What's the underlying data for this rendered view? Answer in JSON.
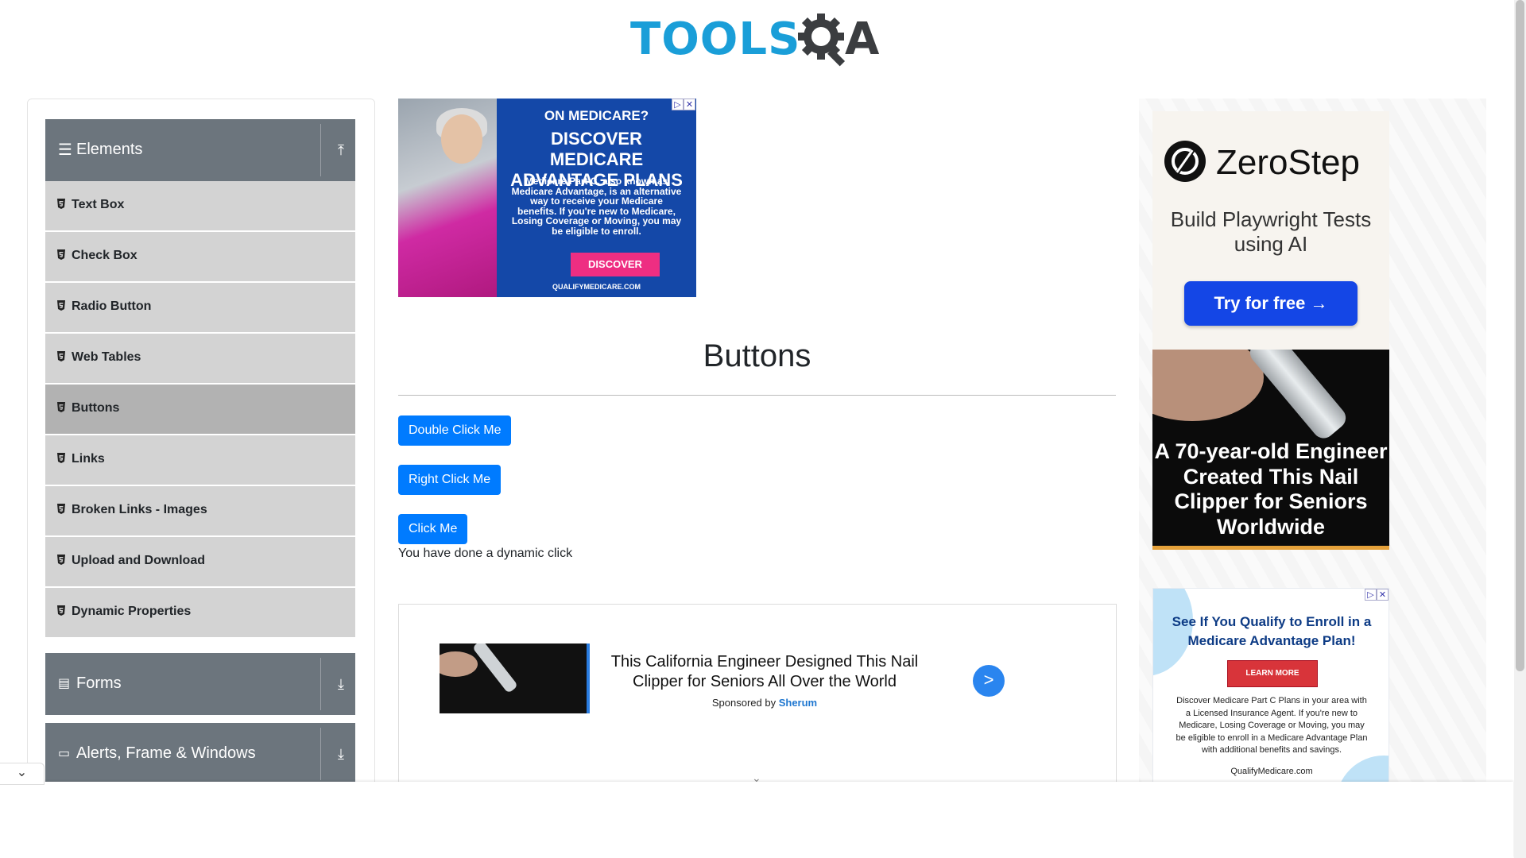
{
  "header": {
    "logo_text_left": "TOOLS",
    "logo_text_right": "A"
  },
  "sidebar": {
    "groups": [
      {
        "label": "Elements",
        "icon": "hamburger-icon",
        "arrow": "collapse-up-icon"
      },
      {
        "label": "Forms",
        "icon": "document-icon",
        "arrow": "expand-down-icon"
      },
      {
        "label": "Alerts, Frame & Windows",
        "icon": "window-icon",
        "arrow": "expand-down-icon"
      }
    ],
    "items": [
      {
        "label": "Text Box"
      },
      {
        "label": "Check Box"
      },
      {
        "label": "Radio Button"
      },
      {
        "label": "Web Tables"
      },
      {
        "label": "Buttons",
        "active": true
      },
      {
        "label": "Links"
      },
      {
        "label": "Broken Links - Images"
      },
      {
        "label": "Upload and Download"
      },
      {
        "label": "Dynamic Properties"
      }
    ]
  },
  "ad_top": {
    "line1": "ON MEDICARE?",
    "line2": "DISCOVER MEDICARE ADVANTAGE PLANS",
    "body": "Medicare Part C, also known as Medicare Advantage, is an alternative way to receive your Medicare benefits. If you're new to Medicare, Losing Coverage or Moving, you may be eligible to enroll.",
    "button": "DISCOVER",
    "site": "QUALIFYMEDICARE.COM"
  },
  "main": {
    "title": "Buttons",
    "double_click_label": "Double Click Me",
    "right_click_label": "Right Click Me",
    "click_label": "Click Me",
    "dynamic_message": "You have done a dynamic click"
  },
  "sponsored": {
    "headline": "This California Engineer Designed This Nail Clipper for Seniors All Over the World",
    "sponsored_by": "Sponsored by",
    "sponsor": "Sherum",
    "go_button": ">"
  },
  "right_ads": {
    "zerostep": {
      "name": "ZeroStep",
      "tagline": "Build Playwright Tests using AI",
      "button": "Try for free →"
    },
    "nail": {
      "caption": "A 70-year-old Engineer Created This Nail Clipper for Seniors Worldwide"
    },
    "medicare": {
      "headline": "See If You Qualify to Enroll in a Medicare Advantage Plan!",
      "button": "LEARN MORE",
      "body": "Discover Medicare Part C Plans in your area with a Licensed Insurance Agent. If you're new to Medicare, Losing Coverage or Moving, you may be eligible to enroll in a Medicare Advantage Plan with additional benefits and savings.",
      "site": "QualifyMedicare.com"
    }
  },
  "colors": {
    "primary": "#007bff",
    "group_header": "#6c757d",
    "menu_item": "#d3d3d3",
    "menu_active": "#b2b2b2",
    "logo_blue": "#1a9ed8"
  }
}
